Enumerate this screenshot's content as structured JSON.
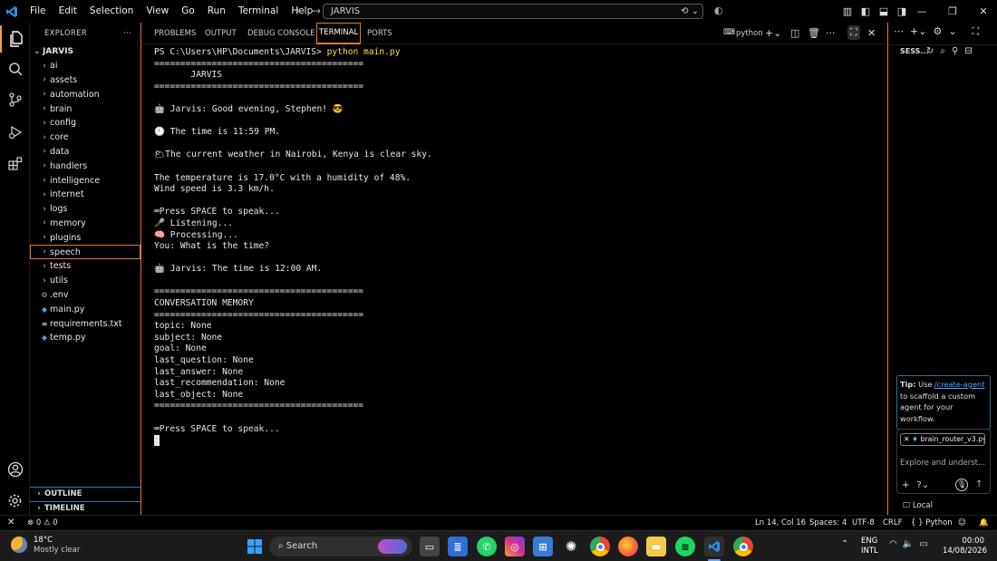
{
  "titlebar": {
    "menu": [
      "File",
      "Edit",
      "Selection",
      "View",
      "Go",
      "Run",
      "Terminal",
      "Help"
    ],
    "search_text": "JARVIS"
  },
  "explorer": {
    "header": "EXPLORER",
    "more": "···",
    "root": "JARVIS",
    "folders": [
      "ai",
      "assets",
      "automation",
      "brain",
      "config",
      "core",
      "data",
      "handlers",
      "intelligence",
      "internet",
      "logs",
      "memory",
      "plugins",
      "speech",
      "tests",
      "utils"
    ],
    "files": [
      ".env",
      "main.py",
      "requirements.txt",
      "temp.py"
    ],
    "outline": "OUTLINE",
    "timeline": "TIMELINE"
  },
  "panel": {
    "tabs": [
      "PROBLEMS",
      "OUTPUT",
      "DEBUG CONSOLE",
      "TERMINAL",
      "PORTS"
    ],
    "active_tab": "TERMINAL",
    "shell_label": "python"
  },
  "terminal": {
    "prompt": "PS C:\\Users\\HP\\Documents\\JARVIS>",
    "command": "python main.py",
    "lines": [
      "========================================",
      "       JARVIS",
      "========================================",
      "",
      "🤖 Jarvis: Good evening, Stephen! 😎",
      "",
      "🕚 The time is 11:59 PM.",
      "",
      "🌥The current weather in Nairobi, Kenya is clear sky.",
      "",
      "The temperature is 17.0°C with a humidity of 48%.",
      "Wind speed is 3.3 km/h.",
      "",
      "⌨Press SPACE to speak...",
      "🎤 Listening...",
      "🧠 Processing...",
      "You: What is the time?",
      "",
      "🤖 Jarvis: The time is 12:00 AM.",
      "",
      "========================================",
      "CONVERSATION MEMORY",
      "========================================",
      "topic: None",
      "subject: None",
      "goal: None",
      "last_question: None",
      "last_answer: None",
      "last_recommendation: None",
      "last_object: None",
      "========================================",
      "",
      "⌨Press SPACE to speak..."
    ]
  },
  "chat": {
    "title": "SESS...",
    "tip_bold": "Tip:",
    "tip_pre": " Use ",
    "tip_link": "/create-agent",
    "tip_post": " to scaffold a custom agent for your workflow.",
    "file_chip": "brain_router_v3.py",
    "input_placeholder": "Explore and underst...",
    "mode": "Local"
  },
  "statusbar": {
    "problems": "0",
    "warnings": "0",
    "position": "Ln 14, Col 16",
    "spaces": "Spaces: 4",
    "encoding": "UTF-8",
    "eol": "CRLF",
    "language": "Python"
  },
  "taskbar": {
    "weather_temp": "18°C",
    "weather_desc": "Mostly clear",
    "search": "Search",
    "lang1": "ENG",
    "lang2": "INTL",
    "time": "00:00",
    "date": "14/08/2026"
  },
  "colors": {
    "accent": "#e07b2c",
    "link": "#4aa3ff",
    "command": "#f2e34a",
    "vscode_blue": "#2a8ee8"
  }
}
